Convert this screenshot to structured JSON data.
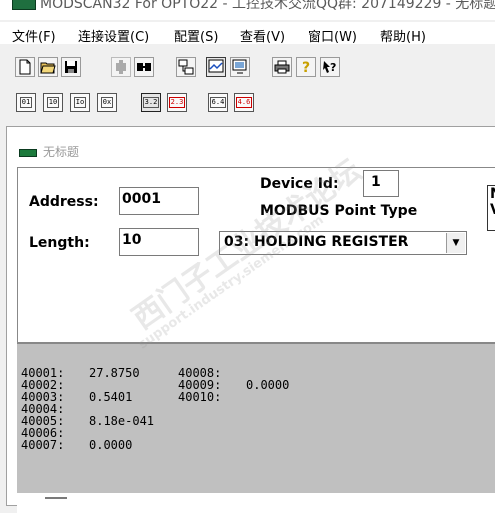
{
  "window": {
    "title": "MODSCAN32 For OPTO22 - 工控技术交流QQ群: 207149229 - 无标题"
  },
  "menu": [
    {
      "label": "文件(F)"
    },
    {
      "label": "连接设置(C)"
    },
    {
      "label": "配置(S)"
    },
    {
      "label": "查看(V)"
    },
    {
      "label": "窗口(W)"
    },
    {
      "label": "帮助(H)"
    }
  ],
  "toolbar1": [
    {
      "icon": "new-file-icon"
    },
    {
      "icon": "open-folder-icon"
    },
    {
      "icon": "save-icon"
    },
    {
      "icon": "connect-icon"
    },
    {
      "icon": "disconnect-icon"
    },
    {
      "icon": "network-icon"
    },
    {
      "icon": "chart-icon"
    },
    {
      "icon": "window-icon"
    },
    {
      "icon": "print-icon"
    },
    {
      "icon": "help-icon"
    },
    {
      "icon": "context-help-icon"
    }
  ],
  "toolbar2": [
    {
      "label": "01",
      "icon": "coil-status-icon"
    },
    {
      "label": "10",
      "icon": "input-status-icon"
    },
    {
      "label": "Io",
      "icon": "input-register-icon"
    },
    {
      "label": "0x",
      "icon": "holding-register-icon"
    },
    {
      "label": "3.2",
      "icon": "float-icon"
    },
    {
      "label": "2.3",
      "icon": "swapped-float-icon"
    },
    {
      "label": "6.4",
      "icon": "double-icon"
    },
    {
      "label": "4.6",
      "icon": "swapped-double-icon"
    }
  ],
  "doc": {
    "title": "无标题",
    "address_label": "Address:",
    "address_value": "0001",
    "length_label": "Length:",
    "length_value": "10",
    "device_id_label": "Device Id:",
    "device_id_value": "1",
    "point_type_label": "MODBUS Point Type",
    "point_type_value": "03: HOLDING REGISTER",
    "right_box_lines": [
      "N",
      "V"
    ]
  },
  "registers_col1": [
    {
      "reg": "40001:",
      "value": "27.8750"
    },
    {
      "reg": "40002:",
      "value": ""
    },
    {
      "reg": "40003:",
      "value": "0.5401"
    },
    {
      "reg": "40004:",
      "value": ""
    },
    {
      "reg": "40005:",
      "value": "8.18e-041"
    },
    {
      "reg": "40006:",
      "value": ""
    },
    {
      "reg": "40007:",
      "value": "0.0000"
    }
  ],
  "registers_col2": [
    {
      "reg": "40008:",
      "value": ""
    },
    {
      "reg": "40009:",
      "value": "0.0000"
    },
    {
      "reg": "40010:",
      "value": ""
    }
  ],
  "watermark": {
    "line1": "西门子工业技术论坛",
    "line2": "support.industry.siemens.com"
  }
}
